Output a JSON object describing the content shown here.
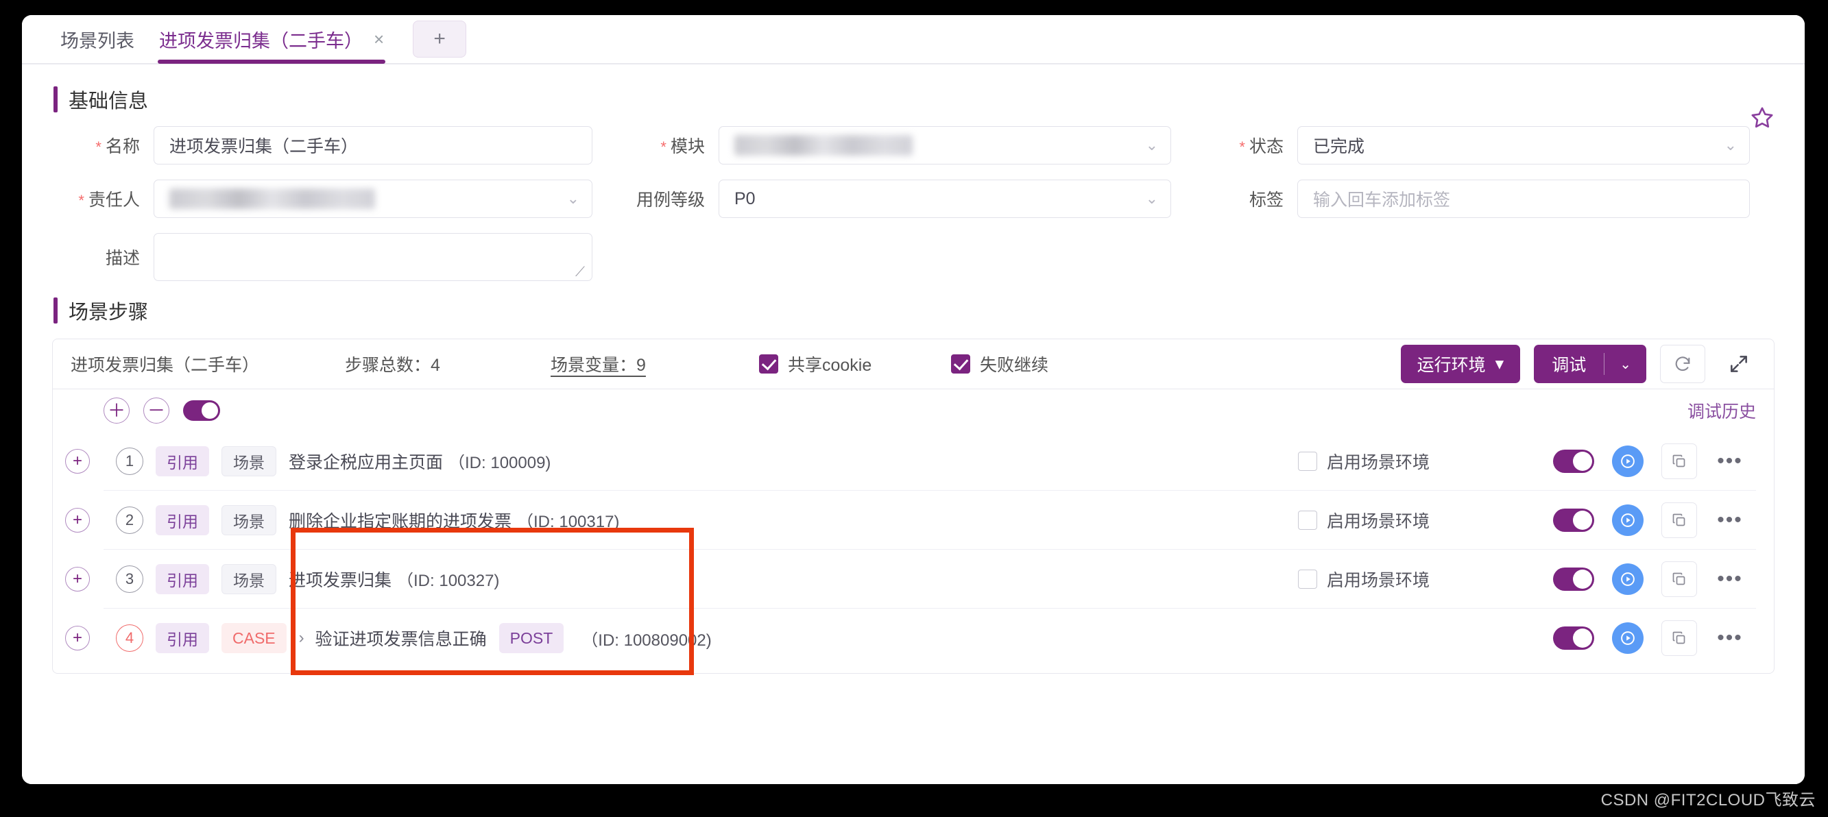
{
  "tabs": [
    {
      "label": "场景列表",
      "active": false,
      "closable": false
    },
    {
      "label": "进项发票归集（二手车）",
      "active": true,
      "closable": true
    }
  ],
  "tab_close_glyph": "×",
  "tab_add_label": "+",
  "sections": {
    "basic_info_title": "基础信息",
    "steps_title": "场景步骤"
  },
  "form": {
    "name": {
      "label": "名称",
      "required": true,
      "value": "进项发票归集（二手车）"
    },
    "module": {
      "label": "模块",
      "required": true,
      "value": "",
      "redacted": true
    },
    "status": {
      "label": "状态",
      "required": true,
      "value": "已完成"
    },
    "owner": {
      "label": "责任人",
      "required": true,
      "value": "",
      "redacted": true
    },
    "case_level": {
      "label": "用例等级",
      "required": false,
      "value": "P0"
    },
    "tag": {
      "label": "标签",
      "required": false,
      "value": "",
      "placeholder": "输入回车添加标签"
    },
    "description": {
      "label": "描述",
      "required": false,
      "value": ""
    }
  },
  "steps_toolbar": {
    "scenario_name": "进项发票归集（二手车）",
    "step_total": "步骤总数：4",
    "scenario_vars": "场景变量：9",
    "share_cookie": {
      "label": "共享cookie",
      "checked": true
    },
    "continue_on_fail": {
      "label": "失败继续",
      "checked": true
    },
    "run_env_button": "运行环境",
    "run_env_caret": "▾",
    "debug_button": "调试",
    "debug_caret": "⌄",
    "refresh_icon": "refresh-icon",
    "expand_icon": "expand-icon"
  },
  "steps_controls": {
    "expand_all": "＋",
    "collapse_all": "－",
    "toggle_on": true,
    "history_link": "调试历史"
  },
  "steps": [
    {
      "num": "1",
      "num_style": "gray",
      "type_badge": "引用",
      "kind_badge": "场景",
      "kind_style": "scene",
      "chevron": false,
      "name": "登录企税应用主页面",
      "method_badge": "",
      "id_text": "（ID: 100009)",
      "env_checkbox": {
        "label": "启用场景环境",
        "checked": false
      },
      "enabled": true
    },
    {
      "num": "2",
      "num_style": "gray",
      "type_badge": "引用",
      "kind_badge": "场景",
      "kind_style": "scene",
      "chevron": false,
      "name": "删除企业指定账期的进项发票",
      "method_badge": "",
      "id_text": "（ID: 100317)",
      "env_checkbox": {
        "label": "启用场景环境",
        "checked": false
      },
      "enabled": true
    },
    {
      "num": "3",
      "num_style": "gray",
      "type_badge": "引用",
      "kind_badge": "场景",
      "kind_style": "scene",
      "chevron": false,
      "name": "进项发票归集",
      "method_badge": "",
      "id_text": "（ID: 100327)",
      "env_checkbox": {
        "label": "启用场景环境",
        "checked": false
      },
      "enabled": true
    },
    {
      "num": "4",
      "num_style": "red",
      "type_badge": "引用",
      "kind_badge": "CASE",
      "kind_style": "case",
      "chevron": true,
      "chevron_glyph": "›",
      "name": "验证进项发票信息正确",
      "method_badge": "POST",
      "id_text": "（ID: 100809002)",
      "env_checkbox": null,
      "enabled": true
    }
  ],
  "row_icons": {
    "play": "play-icon",
    "copy": "copy-icon",
    "more": "•••"
  },
  "favorite_icon": "star-outline-icon",
  "watermark": "CSDN @FIT2CLOUD飞致云",
  "colors": {
    "brand_purple": "#7b2480",
    "annotation_red": "#e8380d",
    "play_blue": "#5a9bf6",
    "required_red": "#f56c6c"
  }
}
